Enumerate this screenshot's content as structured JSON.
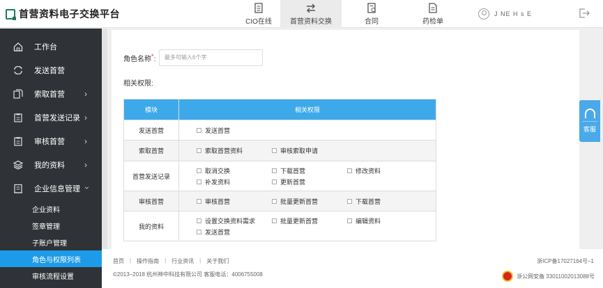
{
  "header": {
    "logo_text": "首营资料电子交换平台",
    "nav": [
      {
        "label": "CIO在线",
        "icon": "document-icon"
      },
      {
        "label": "首营资料交换",
        "icon": "exchange-icon"
      },
      {
        "label": "合同",
        "icon": "contract-icon"
      },
      {
        "label": "药检单",
        "icon": "drug-report-icon"
      }
    ],
    "active_nav": "首营资料交换",
    "username": "J NE H  s E  ",
    "accent_color": "#3ea9ea"
  },
  "sidebar": {
    "items": [
      {
        "label": "工作台",
        "icon": "home-icon"
      },
      {
        "label": "发送首营",
        "icon": "refresh-icon"
      },
      {
        "label": "索取首营",
        "icon": "documents-icon"
      },
      {
        "label": "首营发送记录",
        "icon": "record-icon"
      },
      {
        "label": "审核首营",
        "icon": "audit-icon"
      },
      {
        "label": "我的资料",
        "icon": "layers-icon"
      },
      {
        "label": "企业信息管理",
        "icon": "building-icon"
      }
    ],
    "subitems": [
      {
        "label": "企业资料"
      },
      {
        "label": "签章管理"
      },
      {
        "label": "子账户管理"
      },
      {
        "label": "角色与权限列表"
      },
      {
        "label": "审核流程设置"
      }
    ],
    "active_subitem": "角色与权限列表",
    "bg_color": "#2f3236",
    "active_color": "#1e9be8"
  },
  "form": {
    "role_label": "角色名称",
    "required_mark": "*",
    "role_placeholder": "最多可输入6个字",
    "perm_label": "相关权限:"
  },
  "table": {
    "headers": [
      "模块",
      "相关权限"
    ],
    "rows": [
      {
        "module": "发送首营",
        "perms": [
          "发送首营"
        ]
      },
      {
        "module": "索取首营",
        "perms": [
          "索取首营资料",
          "审核索取申请"
        ]
      },
      {
        "module": "首营发送记录",
        "perms": [
          "取消交换",
          "下载首营",
          "修改资料",
          "补发资料",
          "更新首营"
        ]
      },
      {
        "module": "审核首营",
        "perms": [
          "审核首营",
          "批量更新首营",
          "下载首营"
        ]
      },
      {
        "module": "我的资料",
        "perms": [
          "设置交换资料需求",
          "批量更新首营",
          "编辑资料",
          "发送首营"
        ]
      }
    ]
  },
  "footer": {
    "links": [
      "首页",
      "操作指南",
      "行业资讯",
      "关于我们"
    ],
    "copyright": "©2013–2018  杭州神中科技有限公司  客服电话：4006755008",
    "icp": "浙ICP备17027164号–1",
    "police": "浙公网安备 33011002013088号"
  },
  "service": {
    "label": "客服"
  }
}
